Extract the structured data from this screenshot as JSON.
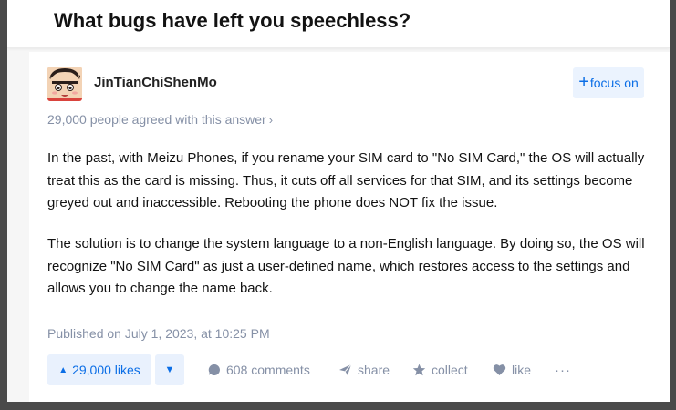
{
  "question": {
    "title": "What bugs have left you speechless?"
  },
  "author": {
    "name": "JinTianChiShenMo",
    "avatar_icon": "cartoon-avatar"
  },
  "focus_button": {
    "icon": "plus-icon",
    "label": "focus on"
  },
  "agreed": {
    "text": "29,000 people agreed with this answer",
    "chevron": "›"
  },
  "answer": {
    "paragraphs": [
      "In the past, with Meizu Phones, if you rename your SIM card to \"No SIM Card,\" the OS will actually treat this as the card is missing. Thus, it cuts off all services for that SIM, and its settings become greyed out and inaccessible. Rebooting the phone does NOT fix the issue.",
      "The solution is to change the system language to a non-English language. By doing so, the OS will recognize \"No SIM Card\" as just a user-defined name, which restores access to the settings and allows you to change the name back."
    ],
    "published": "Published on July 1, 2023, at 10:25 PM"
  },
  "actions": {
    "upvote_icon": "▲",
    "upvote_label": "29,000 likes",
    "downvote_icon": "▼",
    "comments_label": "608 comments",
    "share_label": "share",
    "collect_label": "collect",
    "like_label": "like",
    "more_label": "···"
  },
  "colors": {
    "accent": "#0b6ee6",
    "accent_bg": "#ebf3fe",
    "muted": "#8590a6"
  }
}
